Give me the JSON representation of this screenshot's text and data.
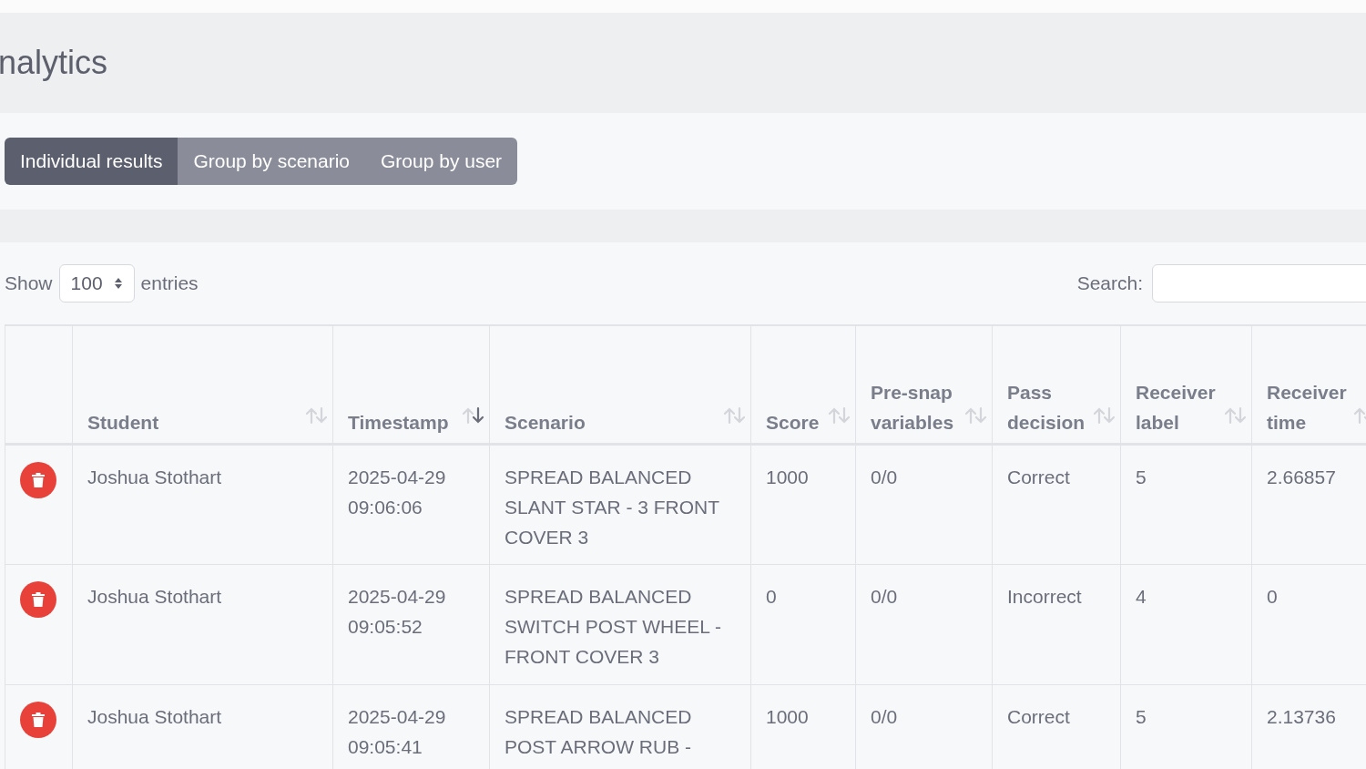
{
  "page_title": "nalytics",
  "view_tabs": [
    {
      "label": "Individual results",
      "selected": true
    },
    {
      "label": "Group by scenario",
      "selected": false
    },
    {
      "label": "Group by user",
      "selected": false
    }
  ],
  "length_control": {
    "before": "Show",
    "value": "100",
    "after": "entries"
  },
  "search": {
    "label": "Search:"
  },
  "table": {
    "columns": [
      {
        "kind": "action"
      },
      {
        "kind": "sortable",
        "label": "Student",
        "sorted": false
      },
      {
        "kind": "sortable",
        "label": "Timestamp",
        "sorted": true
      },
      {
        "kind": "sortable",
        "label": "Scenario",
        "sorted": false
      },
      {
        "kind": "sortable",
        "label": "Score",
        "sorted": false
      },
      {
        "kind": "sortable",
        "label": "Pre-snap variables",
        "sorted": false
      },
      {
        "kind": "sortable",
        "label": "Pass decision",
        "sorted": false
      },
      {
        "kind": "sortable",
        "label": "Receiver label",
        "sorted": false
      },
      {
        "kind": "sortable",
        "label": "Receiver time",
        "sorted": false
      }
    ],
    "rows": [
      {
        "cells": [
          "",
          "Joshua Stothart",
          "2025-04-29 09:06:06",
          "SPREAD BALANCED SLANT STAR - 3 FRONT COVER 3",
          "1000",
          "0/0",
          "Correct",
          "5",
          "2.66857"
        ]
      },
      {
        "cells": [
          "",
          "Joshua Stothart",
          "2025-04-29 09:05:52",
          "SPREAD BALANCED SWITCH POST WHEEL - FRONT COVER 3",
          "0",
          "0/0",
          "Incorrect",
          "4",
          "0"
        ]
      },
      {
        "cells": [
          "",
          "Joshua Stothart",
          "2025-04-29 09:05:41",
          "SPREAD BALANCED POST ARROW RUB -",
          "1000",
          "0/0",
          "Correct",
          "5",
          "2.13736"
        ]
      }
    ]
  }
}
